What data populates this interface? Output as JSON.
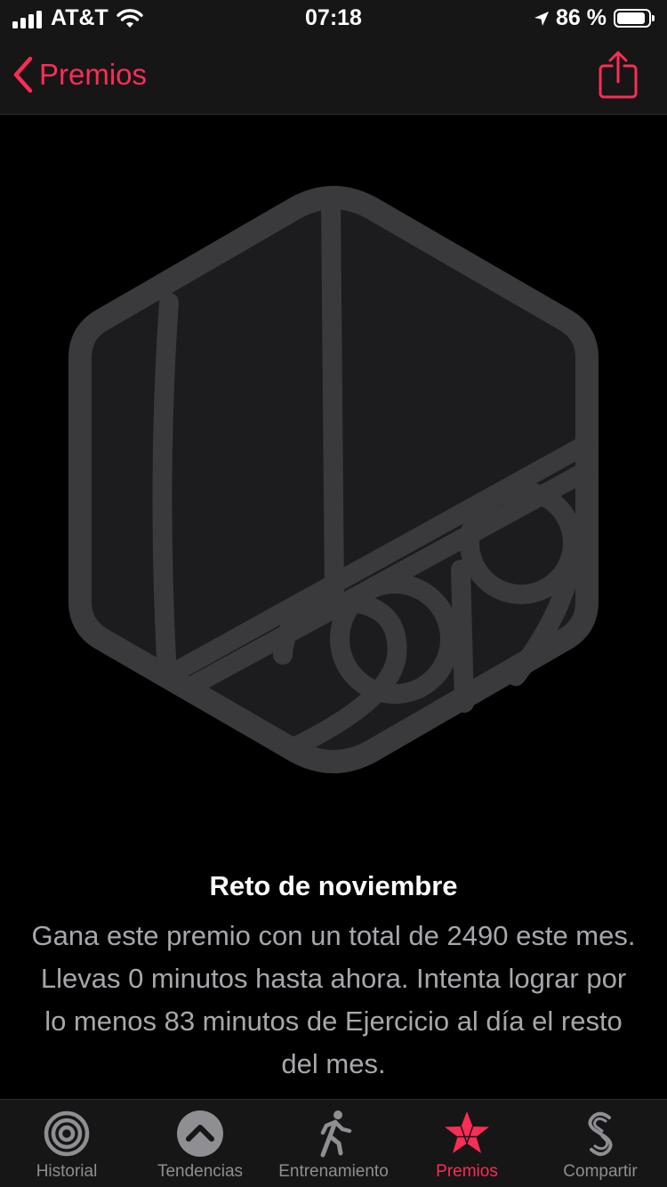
{
  "status_bar": {
    "carrier": "AT&T",
    "time": "07:18",
    "battery": "86 %"
  },
  "nav": {
    "back_label": "Premios",
    "accent": "#fa2d55"
  },
  "badge": {
    "icon": "november-challenge-2019-badge-icon",
    "color": "#3a3a3c"
  },
  "award": {
    "title": "Reto de noviembre",
    "description": "Gana este premio con un total de 2490 este mes. Llevas 0 minutos hasta ahora. Intenta lograr por lo menos 83 minutos de Ejercicio al día el resto del mes."
  },
  "tabs": [
    {
      "label": "Historial",
      "icon": "activity-rings-icon"
    },
    {
      "label": "Tendencias",
      "icon": "trends-chevron-icon"
    },
    {
      "label": "Entrenamiento",
      "icon": "running-figure-icon"
    },
    {
      "label": "Premios",
      "icon": "award-star-icon",
      "active": true
    },
    {
      "label": "Compartir",
      "icon": "sharing-icon"
    }
  ]
}
